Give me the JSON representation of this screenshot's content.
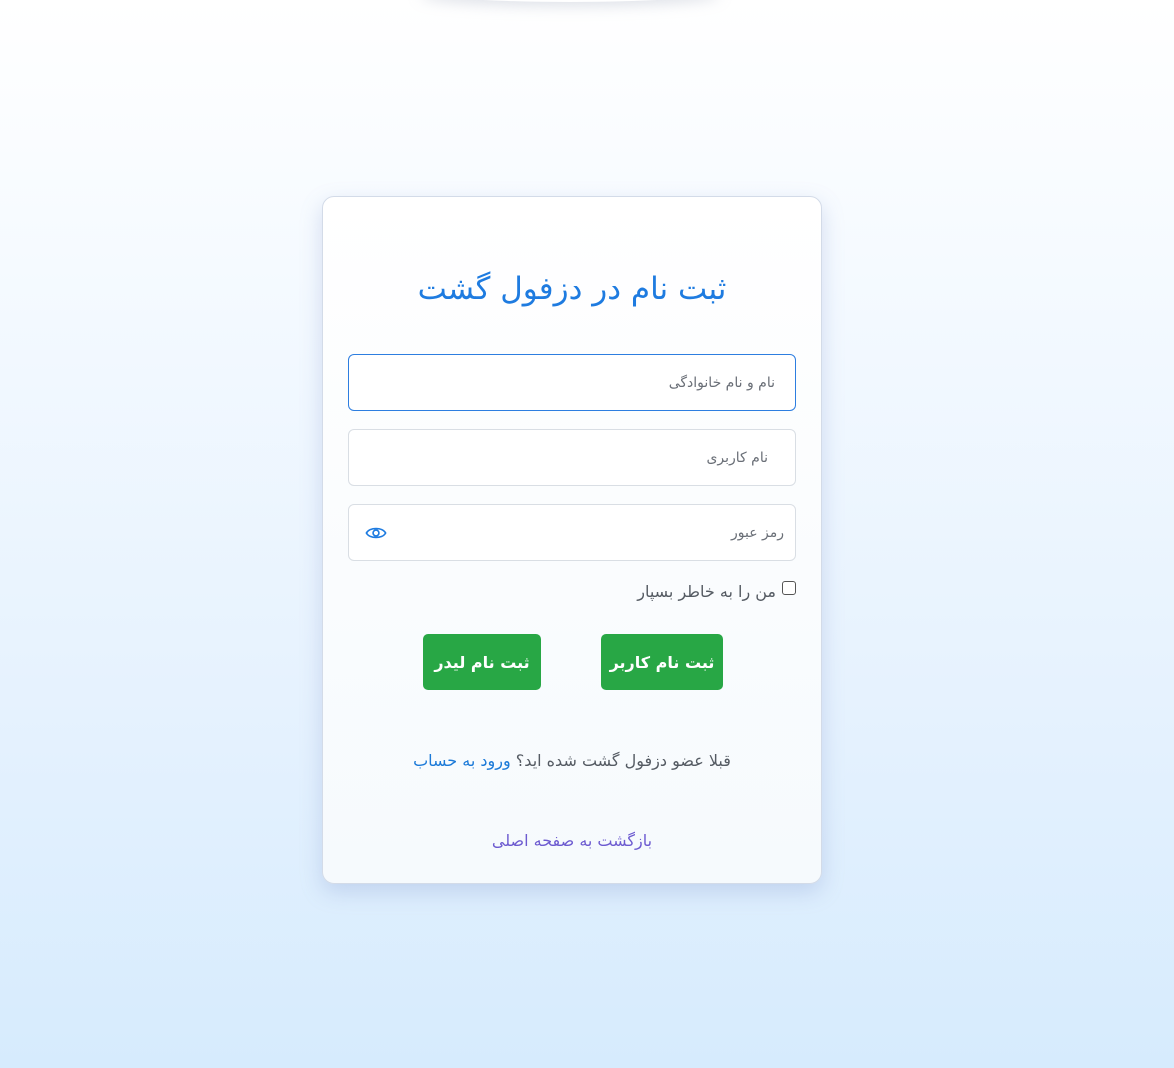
{
  "page": {
    "title": "ثبت نام در دزفول گشت"
  },
  "form": {
    "fullname_placeholder": "نام و نام خانوادگی",
    "username_placeholder": "نام کاربری",
    "password_placeholder": "رمز عبور",
    "remember_label": "من را به خاطر بسپار",
    "remember_checked": false,
    "password_toggle_icon": "eye-icon"
  },
  "buttons": {
    "register_user": "ثبت نام کاربر",
    "register_leader": "ثبت نام لیدر"
  },
  "footer": {
    "already_member": "قبلا عضو دزفول گشت شده اید؟",
    "login_link": "ورود به حساب",
    "back_home": "بازگشت به صفحه اصلی"
  },
  "colors": {
    "accent": "#1e7be0",
    "button_green": "#28a745",
    "back_link": "#6d5bd0"
  }
}
